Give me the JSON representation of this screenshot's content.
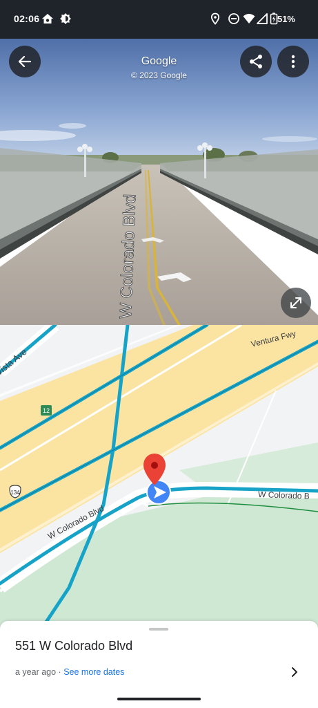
{
  "status_bar": {
    "time": "02:06",
    "battery": "51%",
    "icons": [
      "home-icon",
      "brightness-icon",
      "location-icon",
      "do-not-disturb-icon",
      "wifi-icon",
      "signal-icon",
      "battery-icon"
    ]
  },
  "street_view": {
    "title": "Google",
    "copyright": "© 2023 Google",
    "street_label": "W Colorado Blvd",
    "buttons": [
      "back-arrow-icon",
      "share-icon",
      "more-vert-icon",
      "expand-icon"
    ]
  },
  "map": {
    "labels": {
      "vista_ave": "Vista Ave",
      "ventura_fwy": "Ventura Fwy",
      "route_12": "12",
      "route_134": "134",
      "colorado_left": "W Colorado Blvd",
      "colorado_right": "W Colorado B"
    },
    "colors": {
      "freeway": "#fbe3a1",
      "streetview_line": "#16a3c7",
      "park": "#cfe8d4",
      "pin": "#ea4335",
      "pegman": "#4285f4"
    }
  },
  "place_sheet": {
    "address": "551 W Colorado Blvd",
    "age": "a year ago",
    "separator": " · ",
    "more_dates": "See more dates"
  }
}
